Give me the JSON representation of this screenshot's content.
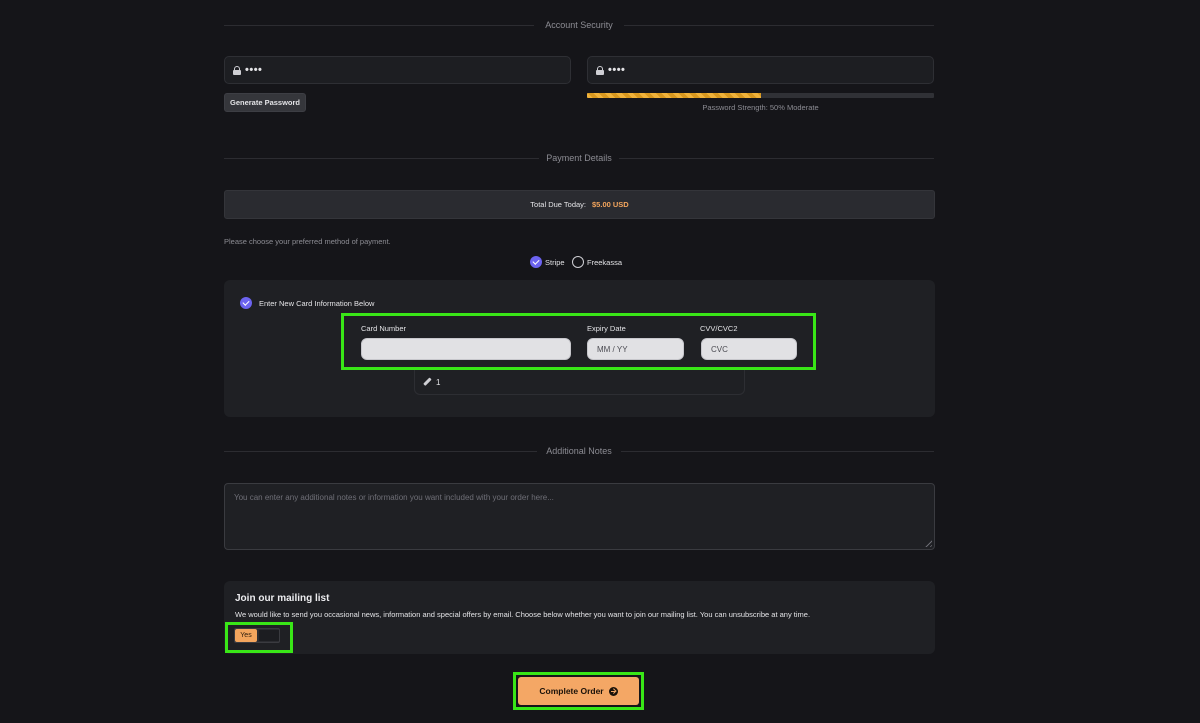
{
  "account_security": {
    "heading": "Account Security",
    "password": {
      "value": "••••"
    },
    "confirm_password": {
      "value": "••••"
    },
    "generate_label": "Generate Password",
    "strength": {
      "percent": 50,
      "text": "Password Strength: 50% Moderate",
      "color": "#f0b23a"
    }
  },
  "payment": {
    "heading": "Payment Details",
    "total_label": "Total Due Today:",
    "total_amount": "$5.00 USD",
    "prompt": "Please choose your preferred method of payment.",
    "gateways": [
      {
        "label": "Stripe",
        "selected": true
      },
      {
        "label": "Freekassa",
        "selected": false
      }
    ],
    "new_card_label": "Enter New Card Information Below",
    "card_number": {
      "label": "Card Number",
      "value": "",
      "placeholder": ""
    },
    "expiry": {
      "label": "Expiry Date",
      "placeholder": "MM / YY"
    },
    "cvv": {
      "label": "CVV/CVC2",
      "placeholder": "CVC"
    },
    "description_value": "1"
  },
  "notes": {
    "heading": "Additional Notes",
    "placeholder": "You can enter any additional notes or information you want included with your order here..."
  },
  "mailing": {
    "title": "Join our mailing list",
    "description": "We would like to send you occasional news, information and special offers by email. Choose below whether you want to join our mailing list. You can unsubscribe at any time.",
    "toggle_label": "Yes"
  },
  "order": {
    "button_label": "Complete Order"
  },
  "colors": {
    "accent": "#f3a55d",
    "radio": "#6c63f0",
    "highlight": "#39e617"
  }
}
